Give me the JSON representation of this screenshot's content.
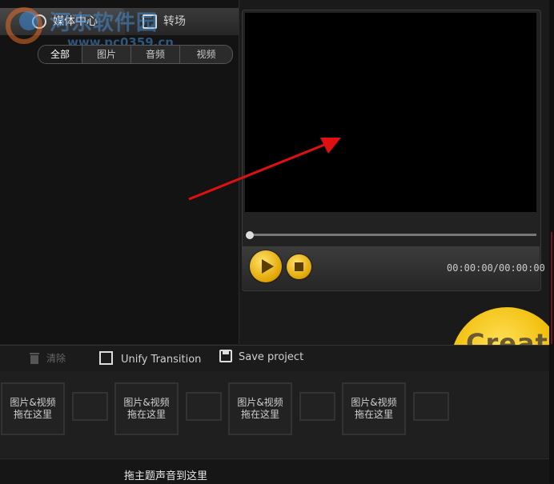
{
  "tabs": {
    "media_center": "媒体中心",
    "transition": "转场"
  },
  "watermark": {
    "title": "河东软件园",
    "url": "www.pc0359.cn"
  },
  "filters": [
    "全部",
    "图片",
    "音频",
    "视频"
  ],
  "preview": {
    "time": "00:00:00/00:00:00"
  },
  "create": {
    "label": "Create"
  },
  "toolbar": {
    "clear_label": "清除",
    "unify_label": "Unify Transition",
    "save_label": "Save project"
  },
  "storyboard": {
    "slots": [
      {
        "line1": "图片&视频",
        "line2": "拖在这里"
      },
      {
        "line1": "图片&视频",
        "line2": "拖在这里"
      },
      {
        "line1": "图片&视频",
        "line2": "拖在这里"
      },
      {
        "line1": "图片&视频",
        "line2": "拖在这里"
      }
    ]
  },
  "audio": {
    "label": "拖主题声音到这里"
  },
  "colors": {
    "accent_gold": "#f0b800",
    "annotation_arrow": "#e01010"
  },
  "icons": [
    "media-center-icon",
    "transition-icon",
    "play-icon",
    "stop-icon",
    "trash-icon",
    "save-icon",
    "checkbox-icon"
  ]
}
